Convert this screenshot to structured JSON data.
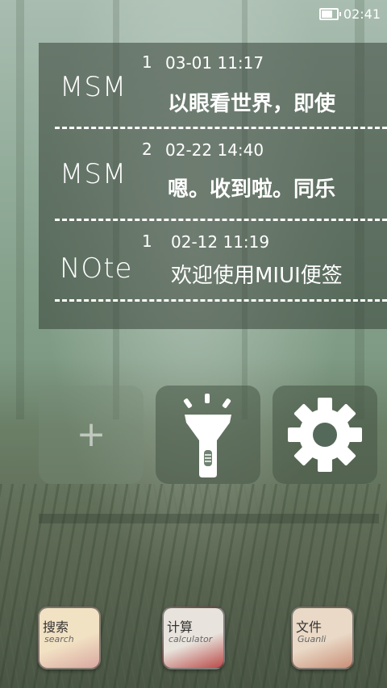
{
  "status": {
    "time": "02:41",
    "battery_level": 0.85
  },
  "notes": [
    {
      "source": "MSM",
      "count": "1",
      "time": "03-01 11:17",
      "text": "以眼看世界，即使"
    },
    {
      "source": "MSM",
      "count": "2",
      "time": "02-22 14:40",
      "text": "嗯。收到啦。同乐"
    },
    {
      "source": "NOte",
      "count": "1",
      "time": "02-12 11:19",
      "text": "欢迎使用MIUI便签"
    }
  ],
  "quick_tiles": [
    {
      "icon": "plus-icon",
      "label": "+"
    },
    {
      "icon": "flashlight-icon"
    },
    {
      "icon": "gear-icon"
    }
  ],
  "dock": [
    {
      "label": "搜索",
      "sub": "search",
      "colors": [
        "#f2e2c4",
        "#d9a8a0"
      ]
    },
    {
      "label": "计算",
      "sub": "calculator",
      "colors": [
        "#e8e3dc",
        "#b94a48"
      ]
    },
    {
      "label": "文件",
      "sub": "Guanli",
      "colors": [
        "#e9d9c6",
        "#c98f78"
      ]
    }
  ]
}
